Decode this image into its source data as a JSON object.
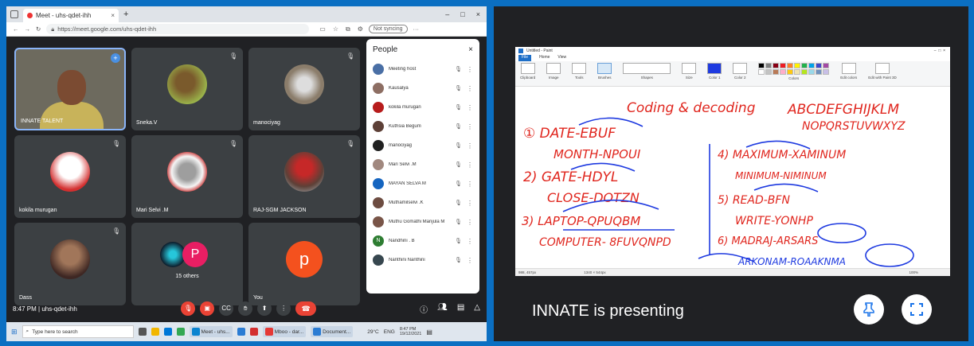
{
  "browser": {
    "tab_title": "Meet - uhs-qdet-ihh",
    "tab_close": "×",
    "new_tab": "+",
    "window_controls": [
      "–",
      "□",
      "×"
    ],
    "url": "https://meet.google.com/uhs-qdet-ihh",
    "sync_label": "Not syncing"
  },
  "meet": {
    "tiles": [
      {
        "name": "INNATE TALENT"
      },
      {
        "name": "Sneka.V"
      },
      {
        "name": "manociyag"
      },
      {
        "name": "kokila murugan"
      },
      {
        "name": "Mari Selvi .M"
      },
      {
        "name": "RAJ-SGM JACKSON"
      },
      {
        "name": "Dass"
      },
      {
        "name": "15 others",
        "initial": "P"
      },
      {
        "name": "You",
        "initial": "p"
      }
    ],
    "people_panel": {
      "title": "People",
      "close": "×",
      "items": [
        {
          "name": "Meeting host",
          "color": "#4a6fa5"
        },
        {
          "name": "Kausalya",
          "color": "#8d6e63"
        },
        {
          "name": "kokila murugan",
          "color": "#b71c1c"
        },
        {
          "name": "Kuthsia Begum",
          "color": "#5d4037"
        },
        {
          "name": "manociyag",
          "color": "#212121"
        },
        {
          "name": "Mari Selvi .M",
          "color": "#a1887f"
        },
        {
          "name": "MAYAN SELVA M",
          "color": "#1565c0"
        },
        {
          "name": "Muthamilselvi .K",
          "color": "#6d4c41"
        },
        {
          "name": "Muthu Gomathi Manjula M",
          "color": "#795548"
        },
        {
          "name": "Nandhini . B",
          "initial": "N",
          "color": "#2e7d32"
        },
        {
          "name": "Nanthini Nanthini",
          "color": "#37474f"
        }
      ]
    },
    "meeting_info": "8:47 PM | uhs-qdet-ihh"
  },
  "taskbar": {
    "search_placeholder": "Type here to search",
    "apps": [
      "Meet - uhs...",
      "Mboo - dar...",
      "Document..."
    ],
    "weather": "29°C",
    "lang": "ENG",
    "time": "8:47 PM",
    "date": "19/12/2021"
  },
  "presentation": {
    "paint_title": "Untitled - Paint",
    "paint_menu": [
      "File",
      "Home",
      "View"
    ],
    "ribbon_groups": [
      "Clipboard",
      "Image",
      "Tools",
      "Brushes",
      "Shapes",
      "Size",
      "Color 1",
      "Color 2",
      "Colors",
      "Edit colors",
      "Edit with Paint 3D"
    ],
    "palette": [
      "#000000",
      "#7f7f7f",
      "#880015",
      "#ed1c24",
      "#ff7f27",
      "#fff200",
      "#22b14c",
      "#00a2e8",
      "#3f48cc",
      "#a349a4",
      "#ffffff",
      "#c3c3c3",
      "#b97a57",
      "#ffaec9",
      "#ffc90e",
      "#efe4b0",
      "#b5e61d",
      "#99d9ea",
      "#7092be",
      "#c8bfe7"
    ],
    "status": {
      "pos": "988, 457px",
      "size": "1340 × 544px",
      "zoom": "100%"
    },
    "whiteboard": {
      "title": "Coding & decoding",
      "alphabet_1": "ABCDEFGHIJKLM",
      "alphabet_2": "NOPQRSTUVWXYZ",
      "lines_left": [
        "① DATE-EBUF",
        "MONTH-NPOUI",
        "2) GATE-HDYL",
        "CLOSE-DOTZN",
        "3) LAPTOP-QPUQBM",
        "COMPUTER- 8FUVQNPD"
      ],
      "lines_right": [
        "4) MAXIMUM-XAMINUM",
        "MINIMUM-NIMINUM",
        "5) READ-BFN",
        "WRITE-YONHP",
        "6) MADRAJ-ARSARS",
        "ARKONAM-ROAAKNMA"
      ]
    },
    "presenting_text": "INNATE  is presenting"
  },
  "colors": {
    "accent": "#8ab4f8",
    "end_call": "#ea4335",
    "meet_bg": "#202124",
    "ink": "#1e3ae0",
    "red_ink": "#e0261e"
  }
}
